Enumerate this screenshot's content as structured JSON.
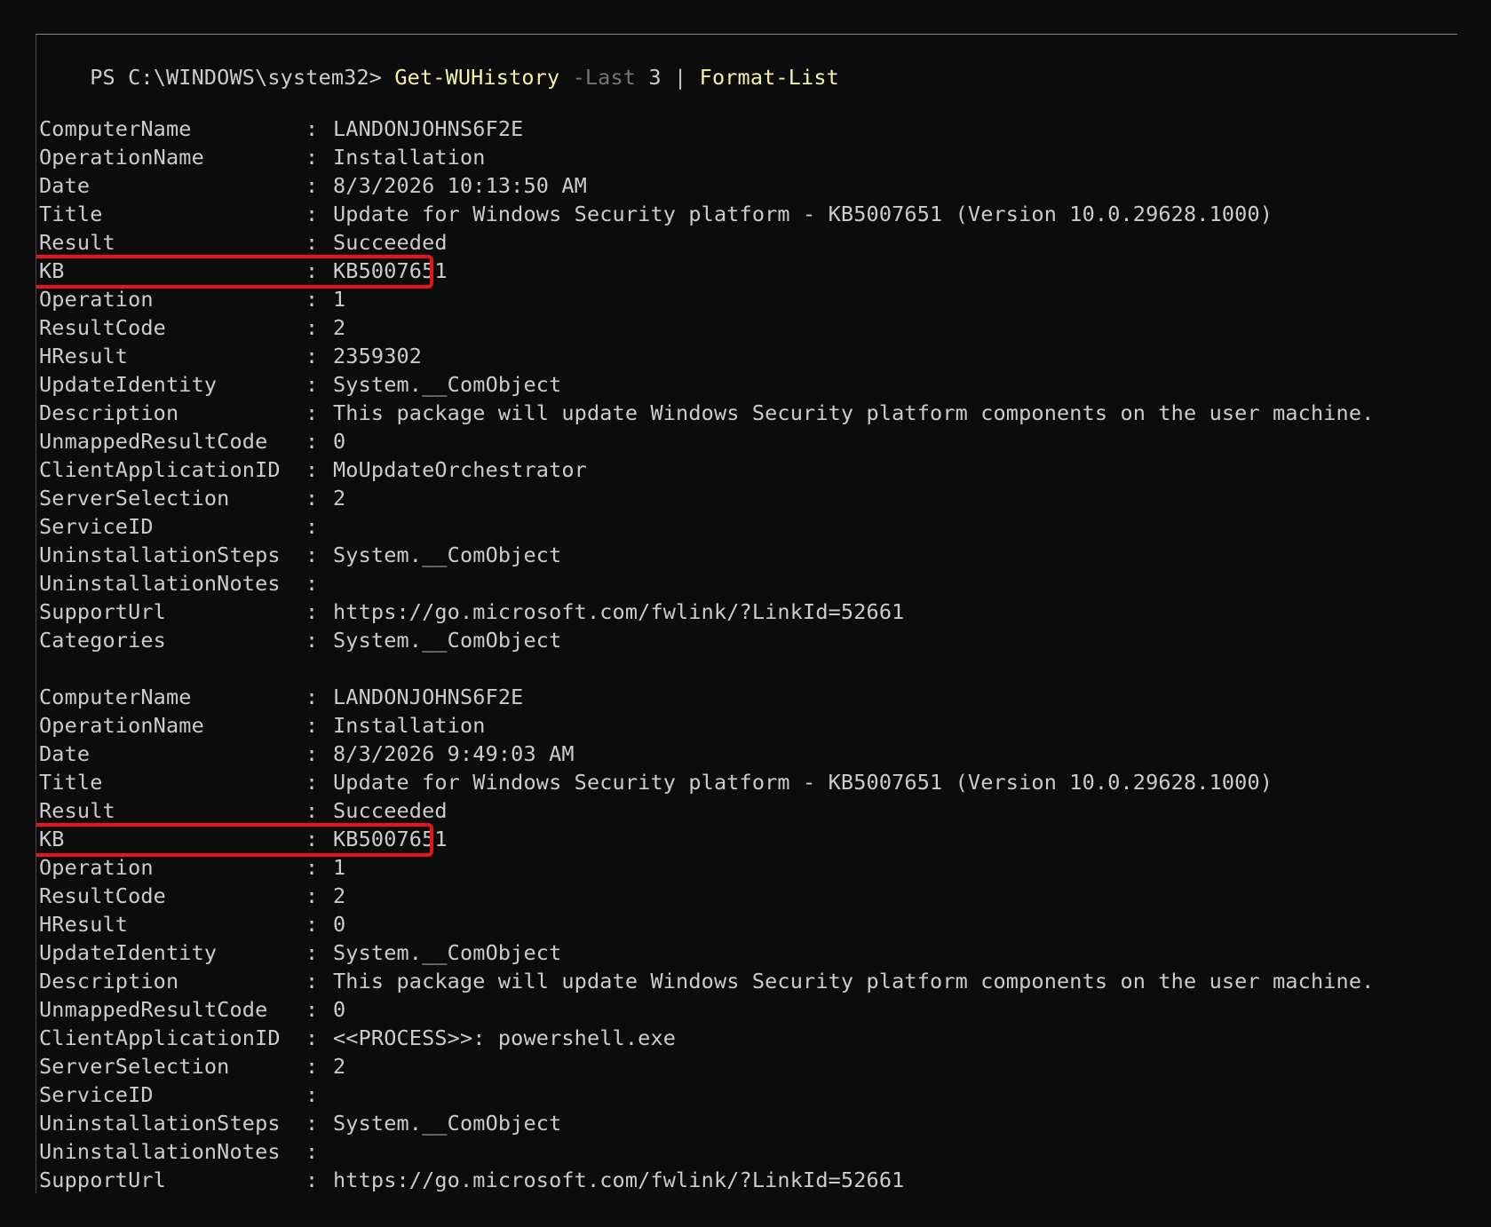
{
  "prompt": {
    "path": "PS C:\\WINDOWS\\system32> ",
    "cmdlet": "Get-WUHistory",
    "param": "-Last",
    "param_value": "3",
    "pipe": "|",
    "format_cmd": "Format-List"
  },
  "colors": {
    "background": "#0c0c0c",
    "text": "#cccccc",
    "command": "#f9f1a5",
    "parameter": "#767676",
    "highlight": "#e8141c"
  },
  "separator": ":",
  "records": [
    {
      "fields": [
        {
          "key": "ComputerName",
          "value": "LANDONJOHNS6F2E"
        },
        {
          "key": "OperationName",
          "value": "Installation"
        },
        {
          "key": "Date",
          "value": "8/3/2026 10:13:50 AM"
        },
        {
          "key": "Title",
          "value": "Update for Windows Security platform - KB5007651 (Version 10.0.29628.1000)"
        },
        {
          "key": "Result",
          "value": "Succeeded"
        },
        {
          "key": "KB",
          "value": "KB5007651",
          "highlighted": true
        },
        {
          "key": "Operation",
          "value": "1"
        },
        {
          "key": "ResultCode",
          "value": "2"
        },
        {
          "key": "HResult",
          "value": "2359302"
        },
        {
          "key": "UpdateIdentity",
          "value": "System.__ComObject"
        },
        {
          "key": "Description",
          "value": "This package will update Windows Security platform components on the user machine."
        },
        {
          "key": "UnmappedResultCode",
          "value": "0"
        },
        {
          "key": "ClientApplicationID",
          "value": "MoUpdateOrchestrator"
        },
        {
          "key": "ServerSelection",
          "value": "2"
        },
        {
          "key": "ServiceID",
          "value": ""
        },
        {
          "key": "UninstallationSteps",
          "value": "System.__ComObject"
        },
        {
          "key": "UninstallationNotes",
          "value": ""
        },
        {
          "key": "SupportUrl",
          "value": "https://go.microsoft.com/fwlink/?LinkId=52661"
        },
        {
          "key": "Categories",
          "value": "System.__ComObject"
        }
      ]
    },
    {
      "fields": [
        {
          "key": "ComputerName",
          "value": "LANDONJOHNS6F2E"
        },
        {
          "key": "OperationName",
          "value": "Installation"
        },
        {
          "key": "Date",
          "value": "8/3/2026 9:49:03 AM"
        },
        {
          "key": "Title",
          "value": "Update for Windows Security platform - KB5007651 (Version 10.0.29628.1000)"
        },
        {
          "key": "Result",
          "value": "Succeeded"
        },
        {
          "key": "KB",
          "value": "KB5007651",
          "highlighted": true
        },
        {
          "key": "Operation",
          "value": "1"
        },
        {
          "key": "ResultCode",
          "value": "2"
        },
        {
          "key": "HResult",
          "value": "0"
        },
        {
          "key": "UpdateIdentity",
          "value": "System.__ComObject"
        },
        {
          "key": "Description",
          "value": "This package will update Windows Security platform components on the user machine."
        },
        {
          "key": "UnmappedResultCode",
          "value": "0"
        },
        {
          "key": "ClientApplicationID",
          "value": "<<PROCESS>>: powershell.exe"
        },
        {
          "key": "ServerSelection",
          "value": "2"
        },
        {
          "key": "ServiceID",
          "value": ""
        },
        {
          "key": "UninstallationSteps",
          "value": "System.__ComObject"
        },
        {
          "key": "UninstallationNotes",
          "value": ""
        },
        {
          "key": "SupportUrl",
          "value": "https://go.microsoft.com/fwlink/?LinkId=52661"
        }
      ]
    }
  ]
}
